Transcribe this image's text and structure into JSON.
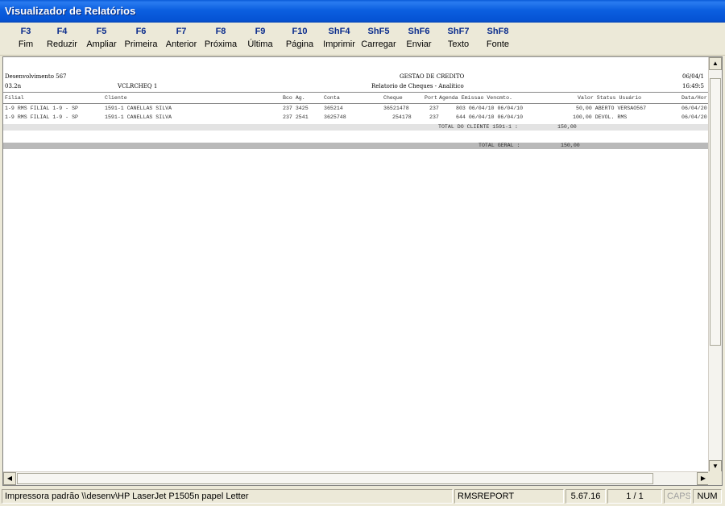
{
  "window": {
    "title": "Visualizador de Relatórios"
  },
  "toolbar": {
    "buttons": [
      {
        "key": "F3",
        "label": "Fim"
      },
      {
        "key": "F4",
        "label": "Reduzir"
      },
      {
        "key": "F5",
        "label": "Ampliar"
      },
      {
        "key": "F6",
        "label": "Primeira"
      },
      {
        "key": "F7",
        "label": "Anterior"
      },
      {
        "key": "F8",
        "label": "Próxima"
      },
      {
        "key": "F9",
        "label": "Última"
      },
      {
        "key": "F10",
        "label": "Página"
      },
      {
        "key": "ShF4",
        "label": "Imprimir"
      },
      {
        "key": "ShF5",
        "label": "Carregar"
      },
      {
        "key": "ShF6",
        "label": "Enviar"
      },
      {
        "key": "ShF7",
        "label": "Texto"
      },
      {
        "key": "ShF8",
        "label": "Fonte"
      }
    ]
  },
  "report": {
    "company": "Desenvolvimento 567",
    "version": "03.2n",
    "program": "VCLRCHEQ 1",
    "system": "GESTAO DE CREDITO",
    "title": "Relatorio de Cheques - Analitico",
    "date": "06/04/1",
    "time": "16:49:5",
    "columns": {
      "filial": "Filial",
      "cliente": "Cliente",
      "bco_ag": "Bco Ag.",
      "conta": "Conta",
      "cheque": "Cheque",
      "port": "Port",
      "agenda_emissao_vencto": "Agenda Emissao  Vencmto.",
      "valor_status_usuario": "Valor Status Usuário",
      "data_hora": "Data/Hor"
    },
    "rows": [
      {
        "filial": "1-9 RMS FILIAL 1-9 - SP",
        "cliente": "1591-1 CANELLAS SILVA",
        "bco_ag": "237 3425",
        "conta": "365214",
        "cheque": "36521478",
        "port": "237",
        "agenda_emissao_vencto": "803 06/04/10 06/04/10",
        "valor_status_usuario": "50,00 ABERTO VERSAO567",
        "data_hora": "06/04/20"
      },
      {
        "filial": "1-9 RMS FILIAL 1-9 - SP",
        "cliente": "1591-1 CANELLAS SILVA",
        "bco_ag": "237 2541",
        "conta": "3625748",
        "cheque": "254178",
        "port": "237",
        "agenda_emissao_vencto": "644 06/04/10 06/04/10",
        "valor_status_usuario": "100,00 DEVOL. RMS",
        "data_hora": "06/04/20"
      }
    ],
    "total_cliente": {
      "label": "TOTAL DO CLIENTE 1591-1 :",
      "value": "150,00"
    },
    "total_geral": {
      "label": "TOTAL GERAL   :",
      "value": "150,00"
    }
  },
  "statusbar": {
    "printer": "Impressora padrão \\\\desenv\\HP LaserJet P1505n papel Letter",
    "module": "RMSREPORT",
    "version": "5.67.16",
    "page": "1 / 1",
    "caps": "CAPS",
    "num": "NUM"
  }
}
